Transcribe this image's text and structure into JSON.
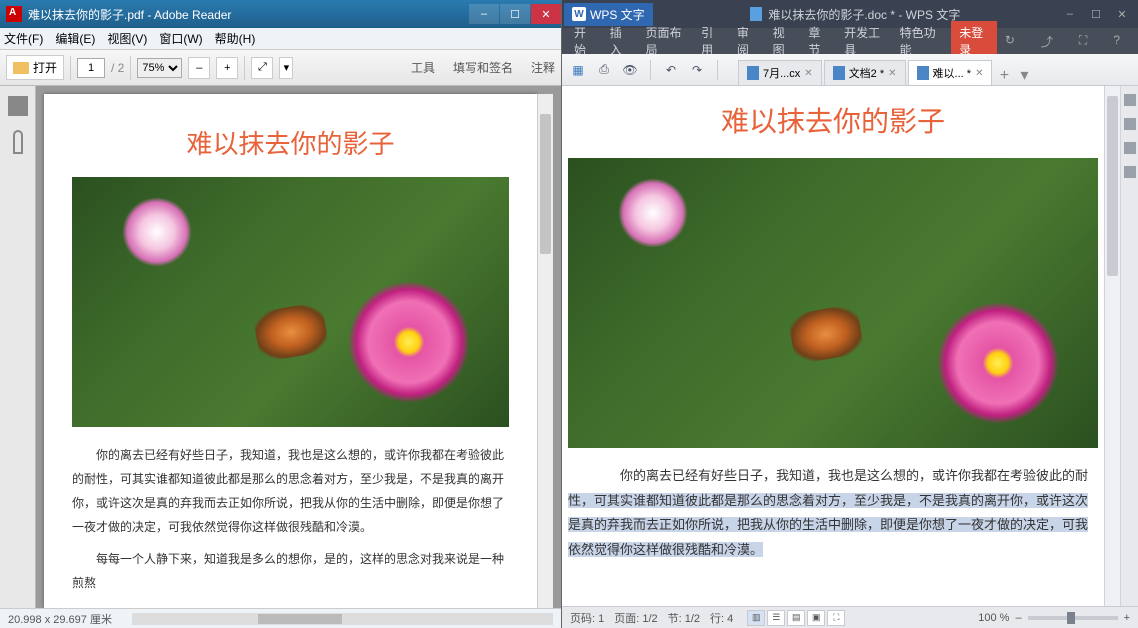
{
  "adobe": {
    "title": "难以抹去你的影子.pdf - Adobe Reader",
    "menu": {
      "file": "文件(F)",
      "edit": "编辑(E)",
      "view": "视图(V)",
      "window": "窗口(W)",
      "help": "帮助(H)"
    },
    "toolbar": {
      "open": "打开",
      "page_current": "1",
      "page_total": "/ 2",
      "zoom": "75%",
      "tools": "工具",
      "fillsign": "填写和签名",
      "comment": "注释"
    },
    "status": {
      "dims": "20.998 x 29.697 厘米"
    },
    "win": {
      "min": "–",
      "max": "☐",
      "close": "✕"
    }
  },
  "wps": {
    "logo": "WPS 文字",
    "title": "难以抹去你的影子.doc * - WPS 文字",
    "tabs": {
      "start": "开始",
      "insert": "插入",
      "layout": "页面布局",
      "ref": "引用",
      "review": "审阅",
      "view": "视图",
      "chapter": "章节",
      "dev": "开发工具",
      "special": "特色功能",
      "login": "未登录"
    },
    "win": {
      "min": "–",
      "max": "☐",
      "close": "✕"
    },
    "ricons": {
      "a": "↻",
      "b": "⤴",
      "c": "⛶",
      "d": "?"
    },
    "quick": {
      "save": "💾",
      "undo": "↶",
      "redo": "↷"
    },
    "doctabs": [
      {
        "icon": "W",
        "label": "7月...cx",
        "dirty": false
      },
      {
        "icon": "W",
        "label": "文档2 *",
        "dirty": true
      },
      {
        "icon": "W",
        "label": "难以... *",
        "dirty": true
      }
    ],
    "status": {
      "page_no": "页码: 1",
      "page": "页面: 1/2",
      "sec": "节: 1/2",
      "row": "行: 4",
      "zoom": "100 %"
    }
  },
  "document": {
    "title": "难以抹去你的影子",
    "p1": "你的离去已经有好些日子，我知道，我也是这么想的，或许你我都在考验彼此的耐性，可其实谁都知道彼此都是那么的思念着对方，至少我是，不是我真的离开你，或许这次是真的弃我而去正如你所说，把我从你的生活中删除，即便是你想了一夜才做的决定，可我依然觉得你这样做很残酷和冷漠。",
    "p2": "每每一个人静下来，知道我是多么的想你，是的，这样的思念对我来说是一种煎熬",
    "wps_p1_a": "你的离去已经有好些日子，我知道，我也是这么想的，或许你我都在考验彼此的耐",
    "wps_p1_b": "性，可其实谁都知道彼此都是那么的思念着对方，至少我是，不是我真的离开你，或许这次是真的弃我而去正如你所说，把我从你的生活中删除，即便是你想了一夜才做的决定，可我依然觉得你这样做很残酷和冷漠。"
  }
}
